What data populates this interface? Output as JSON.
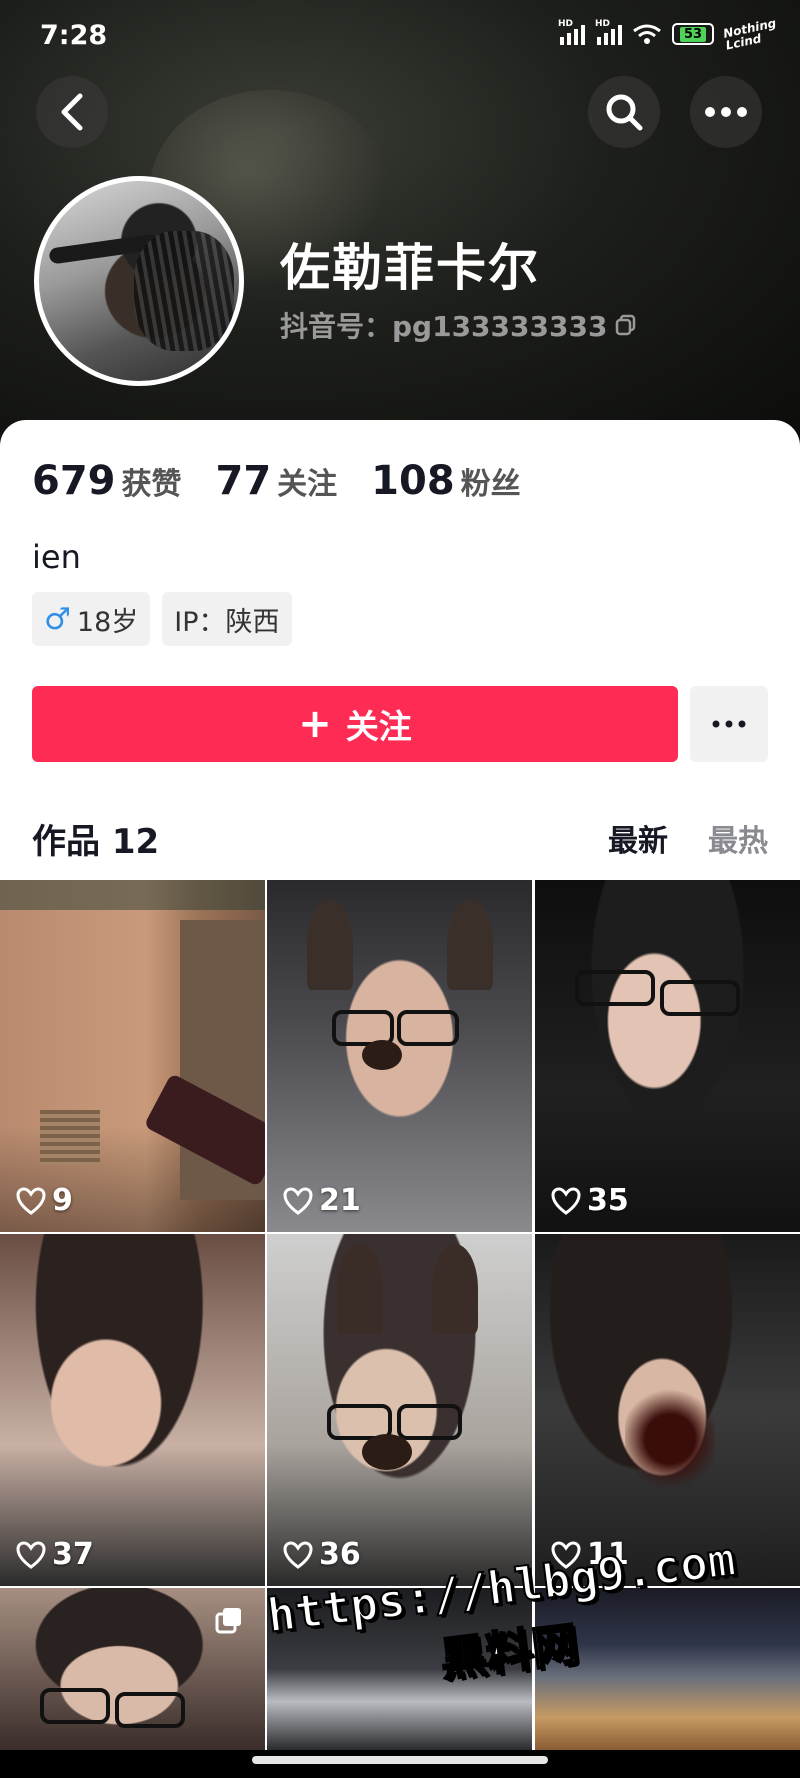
{
  "status_bar": {
    "time": "7:28",
    "signal_1": "HD",
    "signal_2": "HD",
    "battery": "53",
    "brand_mark": "Nothing Lcind"
  },
  "header": {
    "display_name": "佐勒菲卡尔",
    "account_id": "抖音号：pg133333333"
  },
  "stats": [
    {
      "value": "679",
      "label": "获赞"
    },
    {
      "value": "77",
      "label": "关注"
    },
    {
      "value": "108",
      "label": "粉丝"
    }
  ],
  "profile": {
    "bio": "ien",
    "gender_symbol": "♂",
    "age": "18岁",
    "ip": "IP：陕西"
  },
  "actions": {
    "follow_plus": "+",
    "follow_label": "关注"
  },
  "works": {
    "title": "作品 12",
    "sort_latest": "最新",
    "sort_hot": "最热"
  },
  "videos": [
    {
      "likes": "9"
    },
    {
      "likes": "21"
    },
    {
      "likes": "35"
    },
    {
      "likes": "37"
    },
    {
      "likes": "36"
    },
    {
      "likes": "11"
    }
  ],
  "watermark": {
    "url": "https://hlbg9.com",
    "site_name": "黑料网"
  },
  "colors": {
    "accent": "#fe2c55",
    "gender_male": "#2f8fe6",
    "text_primary": "#161823"
  }
}
